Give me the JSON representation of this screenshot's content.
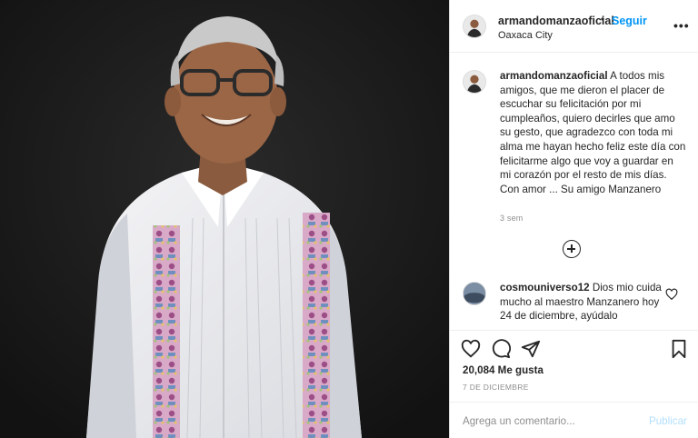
{
  "post": {
    "image_alt": "",
    "header": {
      "username": "armandomanzaoficial",
      "separator": "•",
      "follow_label": "Seguir",
      "location": "Oaxaca City",
      "more_label": "•••"
    },
    "caption": {
      "username": "armandomanzaoficial",
      "text": "A todos mis amigos, que me dieron el placer de escuchar su felicitación por mi cumpleaños, quiero decirles que amo su gesto, que agradezco con toda mi alma me hayan hecho feliz este día con felicitarme algo que voy a guardar en mi corazón por el resto de mis días.",
      "signoff": "Con amor ... Su amigo Manzanero",
      "time": "3 sem"
    },
    "comments": [
      {
        "username": "cosmouniverso12",
        "text": "Dios mio cuida mucho al maestro Manzanero hoy 24 de diciembre, ayúdalo"
      }
    ],
    "likes_text": "20,084 Me gusta",
    "date": "7 DE DICIEMBRE",
    "add_comment": {
      "placeholder": "Agrega un comentario...",
      "publish_label": "Publicar"
    },
    "colors": {
      "accent": "#0095f6",
      "publish_disabled": "#b2dffc",
      "secondary_text": "#8e8e8e",
      "photo_background": "#1b1b1b"
    },
    "icons": {
      "like": "heart-outline-icon",
      "comment": "speech-bubble-icon",
      "share": "paper-plane-icon",
      "save": "bookmark-icon",
      "load_more": "plus-circle-icon",
      "comment_like": "small-heart-icon"
    }
  }
}
